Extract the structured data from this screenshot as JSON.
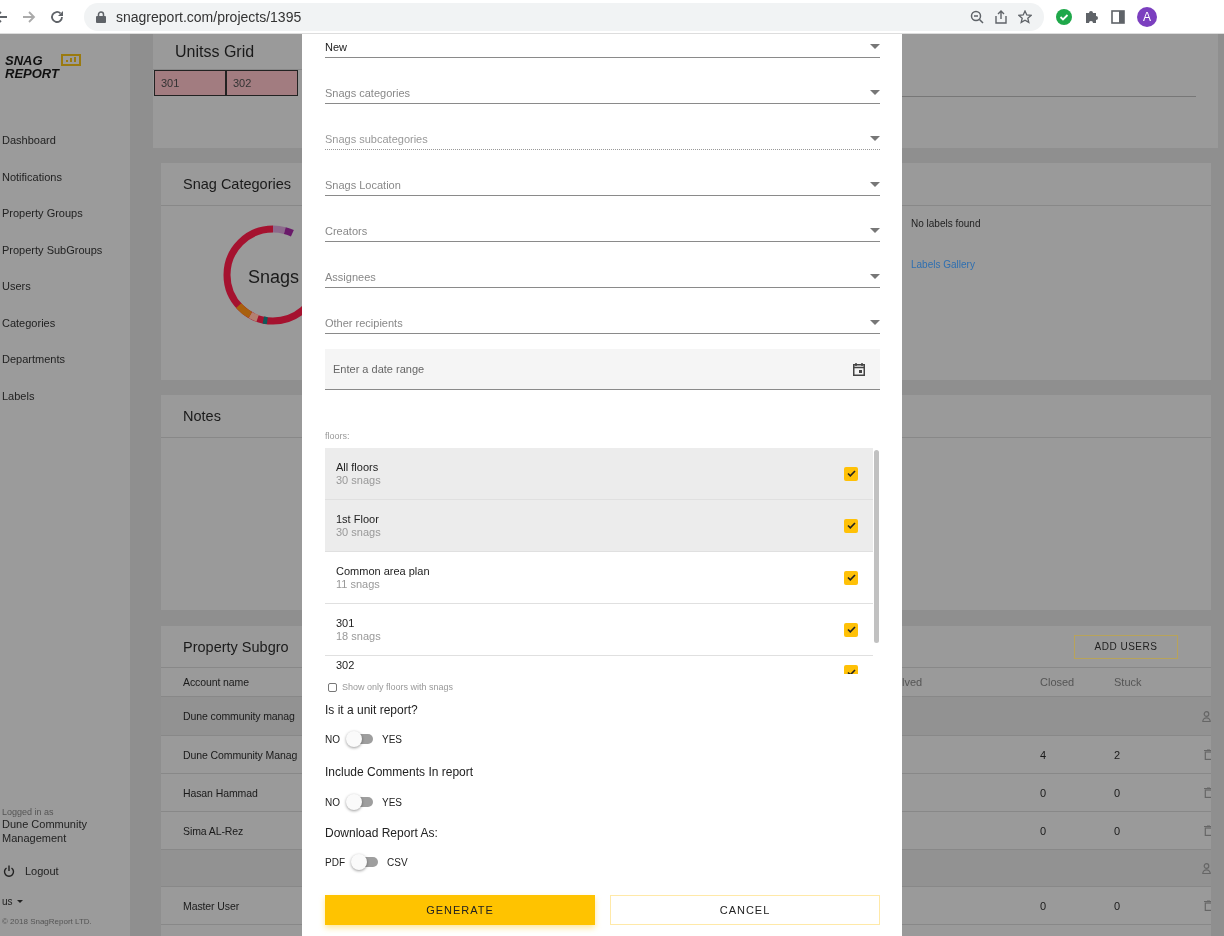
{
  "browser": {
    "url": "snagreport.com/projects/1395",
    "profile_initial": "A"
  },
  "sidebar": {
    "logo_top": "SNAG",
    "logo_bottom": "REPORT",
    "items": [
      {
        "label": "Dashboard"
      },
      {
        "label": "Notifications"
      },
      {
        "label": "Property Groups"
      },
      {
        "label": "Property SubGroups"
      },
      {
        "label": "Users"
      },
      {
        "label": "Categories"
      },
      {
        "label": "Departments"
      },
      {
        "label": "Labels"
      }
    ],
    "logged_in_label": "Logged in as",
    "user_name": "Dune Community Management",
    "logout": "Logout",
    "language": "us",
    "copyright": "© 2018 SnagReport LTD."
  },
  "units_grid": {
    "title": "Unitss Grid",
    "cells": [
      {
        "label": "301"
      },
      {
        "label": "302"
      }
    ]
  },
  "snag_categories": {
    "title": "Snag Categories",
    "donut_center": "Snags",
    "labels_message": "No labels found",
    "labels_link": "Labels Gallery"
  },
  "notes": {
    "title": "Notes"
  },
  "property_subgroups": {
    "title": "Property Subgro",
    "add_button": "ADD USERS",
    "columns": [
      "Account name",
      "lved",
      "Closed",
      "Stuck"
    ],
    "rows": [
      {
        "kind": "group",
        "account": "Dune community manag"
      },
      {
        "kind": "user",
        "account": "Dune Community Manag",
        "closed": "4",
        "stuck": "2"
      },
      {
        "kind": "user",
        "account": "Hasan Hammad",
        "closed": "0",
        "stuck": "0"
      },
      {
        "kind": "user",
        "account": "Sima AL-Rez",
        "closed": "0",
        "stuck": "0"
      },
      {
        "kind": "group"
      },
      {
        "kind": "user",
        "account": "Master User",
        "closed": "0",
        "stuck": "0"
      }
    ]
  },
  "report_dialog": {
    "fields": [
      {
        "value": "New",
        "disabled": false
      },
      {
        "placeholder": "Snags categories",
        "disabled": false
      },
      {
        "placeholder": "Snags subcategories",
        "disabled": true
      },
      {
        "placeholder": "Snags Location",
        "disabled": false
      },
      {
        "placeholder": "Creators",
        "disabled": false
      },
      {
        "placeholder": "Assignees",
        "disabled": false
      },
      {
        "placeholder": "Other recipients",
        "disabled": false
      }
    ],
    "date_range": {
      "placeholder": "Enter a date range"
    },
    "floors": {
      "label": "floors:",
      "items": [
        {
          "name": "All floors",
          "count": "30 snags",
          "selected": true,
          "checked": true
        },
        {
          "name": "1st Floor",
          "count": "30 snags",
          "selected": true,
          "checked": true
        },
        {
          "name": "Common area plan",
          "count": "11 snags",
          "selected": false,
          "checked": true
        },
        {
          "name": "301",
          "count": "18 snags",
          "selected": false,
          "checked": true
        },
        {
          "name": "302",
          "selected": false,
          "checked": true
        }
      ]
    },
    "show_only": {
      "label": "Show only floors with snags",
      "checked": false
    },
    "options": [
      {
        "question": "Is it a unit report?",
        "off_label": "NO",
        "on_label": "YES",
        "on": false
      },
      {
        "question": "Include Comments In report",
        "off_label": "NO",
        "on_label": "YES",
        "on": false
      },
      {
        "question": "Download Report As:",
        "off_label": "PDF",
        "on_label": "CSV",
        "on": false
      }
    ],
    "buttons": [
      {
        "label": "GENERATE",
        "kind": "primary"
      },
      {
        "label": "CANCEL",
        "kind": "secondary"
      }
    ]
  }
}
